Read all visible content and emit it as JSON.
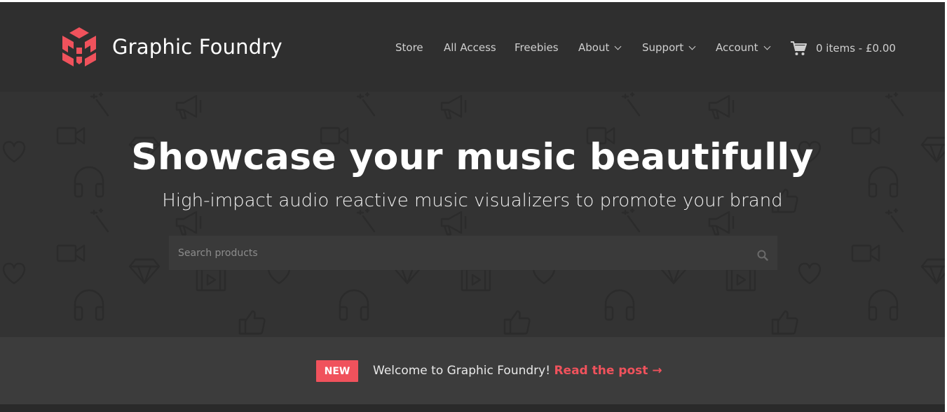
{
  "brand": {
    "name": "Graphic Foundry",
    "logo_icon": "cube-logo-icon",
    "accent_color": "#f0525c"
  },
  "nav": {
    "items": [
      {
        "label": "Store",
        "has_dropdown": false
      },
      {
        "label": "All Access",
        "has_dropdown": false
      },
      {
        "label": "Freebies",
        "has_dropdown": false
      },
      {
        "label": "About",
        "has_dropdown": true
      },
      {
        "label": "Support",
        "has_dropdown": true
      },
      {
        "label": "Account",
        "has_dropdown": true
      }
    ],
    "cart_icon": "shopping-cart-icon",
    "cart_label": "0 items - £0.00"
  },
  "hero": {
    "title": "Showcase your music beautifully",
    "subtitle": "High-impact audio reactive music visualizers to promote your brand",
    "search": {
      "placeholder": "Search products",
      "value": "",
      "icon": "search-icon"
    },
    "pattern_icons": [
      "magic-wand-icon",
      "megaphone-icon",
      "video-camera-icon",
      "heart-icon",
      "diamond-icon",
      "headphones-icon",
      "thumbs-up-icon",
      "film-play-icon"
    ]
  },
  "notice": {
    "badge": "NEW",
    "text": "Welcome to Graphic Foundry!",
    "link_label": "Read the post →"
  }
}
